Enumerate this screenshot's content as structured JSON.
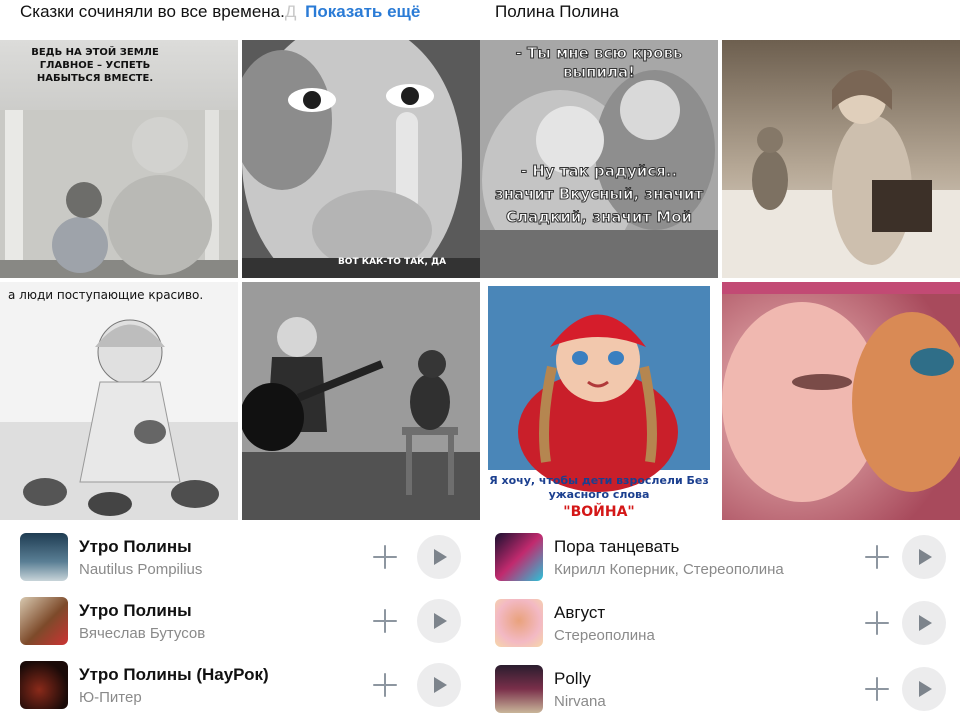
{
  "left_panel": {
    "post_text": "Сказки сочиняли во все времена.",
    "post_text_fade": "Д",
    "show_more": "Показать ещё",
    "photos": [
      {
        "name": "photo-grandma-child",
        "caption": "ВЕДЬ НА ЭТОЙ ЗЕМЛЕ ГЛАВНОЕ – УСПЕТЬ НАБЫТЬСЯ ВМЕСТЕ."
      },
      {
        "name": "photo-girl-finger",
        "caption": "ВОТ КАК-ТО ТАК, ДА"
      },
      {
        "name": "photo-girl-kittens",
        "caption": "а люди поступающие красиво."
      },
      {
        "name": "photo-boy-guitar-cat",
        "caption": ""
      }
    ],
    "tracks": [
      {
        "title": "Утро Полины",
        "artist": "Nautilus Pompilius"
      },
      {
        "title": "Утро Полины",
        "artist": "Вячеслав Бутусов"
      },
      {
        "title": "Утро Полины (НауРок)",
        "artist": "Ю-Питер"
      }
    ]
  },
  "right_panel": {
    "author": "Полина Полина",
    "photos": [
      {
        "name": "photo-kids-kiss",
        "caption_top": "- Ты мне всю кровь выпила!",
        "caption_bottom": "- Ну так радуйся.. значит Вкусный, значит Сладкий, значит Мой"
      },
      {
        "name": "photo-child-snow-cat",
        "caption": ""
      },
      {
        "name": "photo-girl-red-hat",
        "caption": "Я хочу, чтобы дети взрослели Без ужасного слова",
        "caption_red": "\"ВОЙНА\""
      },
      {
        "name": "photo-child-kitten",
        "caption": ""
      }
    ],
    "tracks": [
      {
        "title": "Пора танцевать",
        "artist": "Кирилл Коперник, Стереополина"
      },
      {
        "title": "Август",
        "artist": "Стереополина"
      },
      {
        "title": "Polly",
        "artist": "Nirvana"
      }
    ]
  },
  "icons": {
    "add": "plus-icon",
    "play": "play-icon"
  },
  "colors": {
    "link": "#2a7bd6",
    "secondary_text": "#8a8a8a",
    "icon": "#8d96a0",
    "play_bg": "#ececed"
  }
}
